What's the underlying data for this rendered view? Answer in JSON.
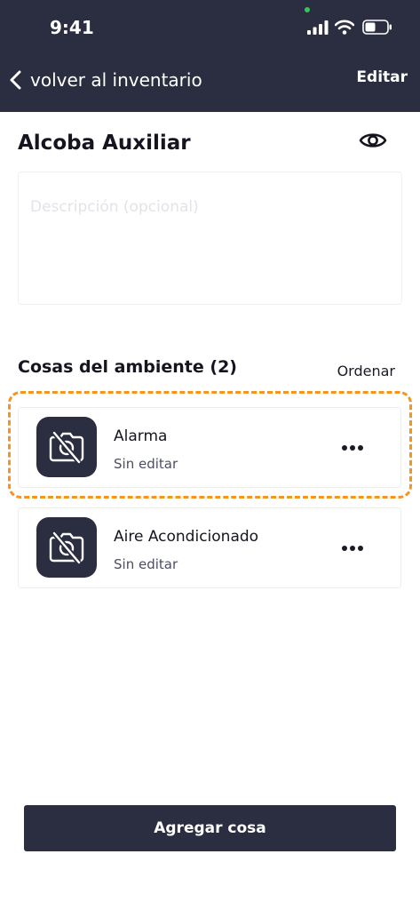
{
  "status_bar": {
    "time": "9:41"
  },
  "nav": {
    "back_label": "volver al inventario",
    "edit_label": "Editar"
  },
  "room": {
    "title": "Alcoba Auxiliar",
    "description_placeholder": "Descripción (opcional)"
  },
  "things": {
    "section_title": "Cosas del ambiente (2)",
    "order_label": "Ordenar",
    "items": [
      {
        "name": "Alarma",
        "status": "Sin editar",
        "icon": "camera-off-icon"
      },
      {
        "name": "Aire Acondicionado",
        "status": "Sin editar",
        "icon": "camera-off-icon"
      }
    ]
  },
  "footer": {
    "add_label": "Agregar cosa"
  },
  "colors": {
    "header": "#2b2d40",
    "highlight": "#f7941d",
    "placeholder": "#e3e3e8"
  }
}
